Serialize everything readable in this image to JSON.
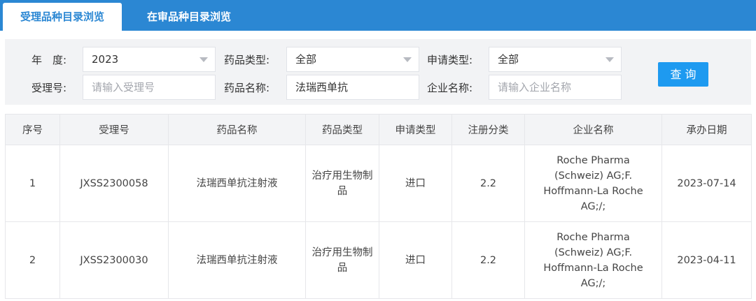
{
  "tabs": {
    "active_label": "受理品种目录浏览",
    "inactive_label": "在审品种目录浏览"
  },
  "search": {
    "year_label": "年　度:",
    "year_value": "2023",
    "drug_type_label": "药品类型:",
    "drug_type_value": "全部",
    "apply_type_label": "申请类型:",
    "apply_type_value": "全部",
    "accept_no_label": "受理号:",
    "accept_no_placeholder": "请输入受理号",
    "drug_name_label": "药品名称:",
    "drug_name_value": "法瑞西单抗",
    "company_label": "企业名称:",
    "company_placeholder": "请输入企业名称",
    "query_label": "查 询"
  },
  "table": {
    "headers": [
      "序号",
      "受理号",
      "药品名称",
      "药品类型",
      "申请类型",
      "注册分类",
      "企业名称",
      "承办日期"
    ],
    "rows": [
      {
        "index": "1",
        "accept_no": "JXSS2300058",
        "drug_name": "法瑞西单抗注射液",
        "drug_type": "治疗用生物制品",
        "apply_type": "进口",
        "reg_class": "2.2",
        "company": "Roche Pharma (Schweiz) AG;F. Hoffmann-La Roche AG;/;",
        "date": "2023-07-14"
      },
      {
        "index": "2",
        "accept_no": "JXSS2300030",
        "drug_name": "法瑞西单抗注射液",
        "drug_type": "治疗用生物制品",
        "apply_type": "进口",
        "reg_class": "2.2",
        "company": "Roche Pharma (Schweiz) AG;F. Hoffmann-La Roche AG;/;",
        "date": "2023-04-11"
      }
    ]
  }
}
